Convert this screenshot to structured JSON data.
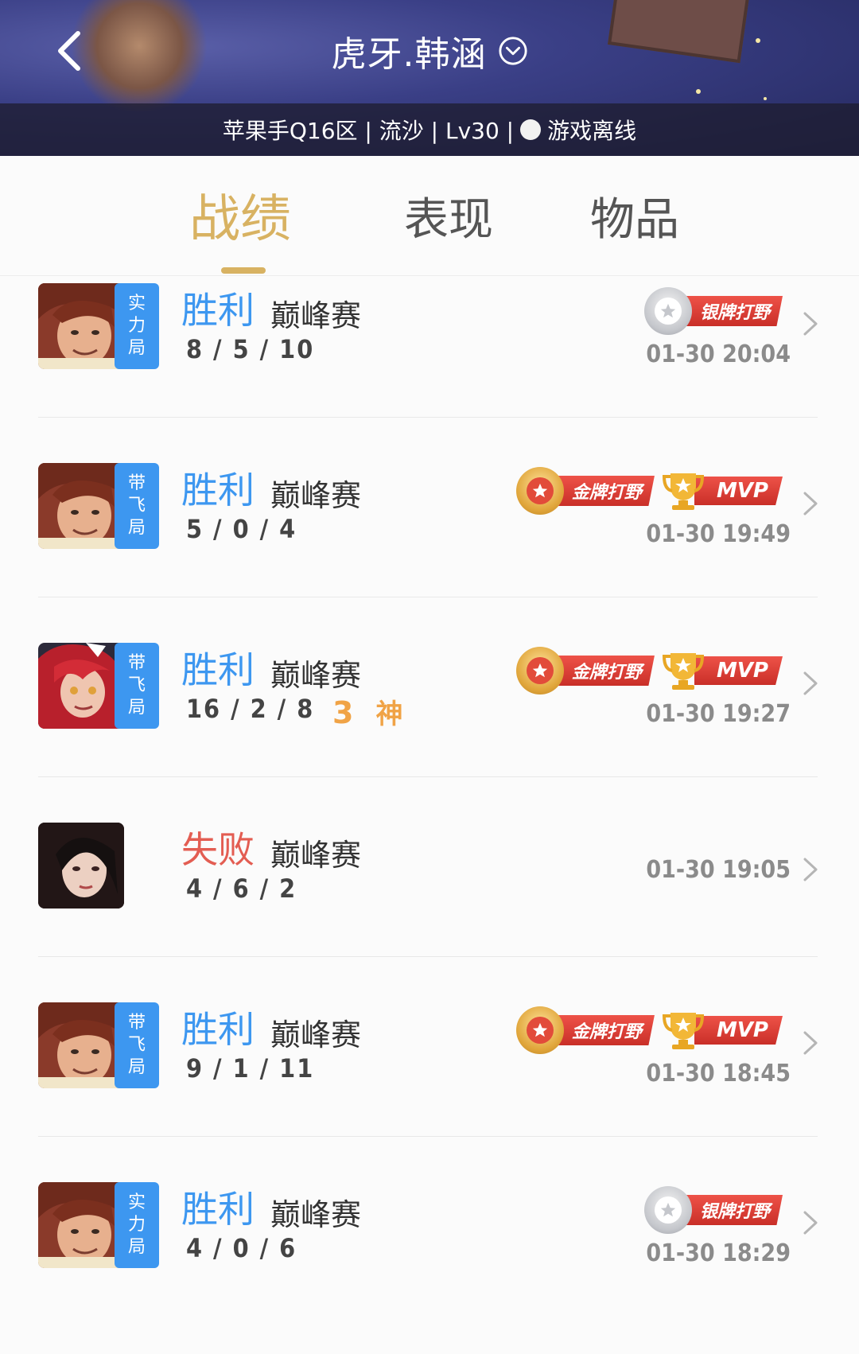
{
  "header": {
    "title": "虎牙.韩涵",
    "subtitle_prefix": "苹果手Q16区 | 流沙 | Lv30 |",
    "status": "游戏离线"
  },
  "tabs": [
    {
      "label": "战绩",
      "active": true
    },
    {
      "label": "表现",
      "active": false
    },
    {
      "label": "物品",
      "active": false
    }
  ],
  "matches": [
    {
      "result": "胜利",
      "outcome": "win",
      "type": "巅峰赛",
      "kda": "8/5/10",
      "mode": [
        "实",
        "力",
        "局"
      ],
      "time": "01-30 20:04",
      "badges": [
        {
          "kind": "silver",
          "label": "银牌打野"
        }
      ],
      "hero": "male-brown-hair"
    },
    {
      "result": "胜利",
      "outcome": "win",
      "type": "巅峰赛",
      "kda": "5/0/4",
      "mode": [
        "带",
        "飞",
        "局"
      ],
      "time": "01-30 19:49",
      "badges": [
        {
          "kind": "gold",
          "label": "金牌打野"
        },
        {
          "kind": "mvp",
          "label": "MVP"
        }
      ],
      "hero": "male-brown-hair"
    },
    {
      "result": "胜利",
      "outcome": "win",
      "type": "巅峰赛",
      "kda": "16/2/8",
      "godlike_count": "3",
      "godlike_label": "神",
      "mode": [
        "带",
        "飞",
        "局"
      ],
      "time": "01-30 19:27",
      "badges": [
        {
          "kind": "gold",
          "label": "金牌打野"
        },
        {
          "kind": "mvp",
          "label": "MVP"
        }
      ],
      "hero": "female-red-hair"
    },
    {
      "result": "失败",
      "outcome": "lose",
      "type": "巅峰赛",
      "kda": "4/6/2",
      "mode": [],
      "time": "01-30 19:05",
      "badges": [],
      "hero": "female-black-hair"
    },
    {
      "result": "胜利",
      "outcome": "win",
      "type": "巅峰赛",
      "kda": "9/1/11",
      "mode": [
        "带",
        "飞",
        "局"
      ],
      "time": "01-30 18:45",
      "badges": [
        {
          "kind": "gold",
          "label": "金牌打野"
        },
        {
          "kind": "mvp",
          "label": "MVP"
        }
      ],
      "hero": "male-brown-hair"
    },
    {
      "result": "胜利",
      "outcome": "win",
      "type": "巅峰赛",
      "kda": "4/0/6",
      "mode": [
        "实",
        "力",
        "局"
      ],
      "time": "01-30 18:29",
      "badges": [
        {
          "kind": "silver",
          "label": "银牌打野"
        }
      ],
      "hero": "male-brown-hair"
    }
  ],
  "colors": {
    "win": "#3d97f0",
    "lose": "#e35d52",
    "accent": "#d8b262",
    "badge_red": "#d8382f"
  }
}
